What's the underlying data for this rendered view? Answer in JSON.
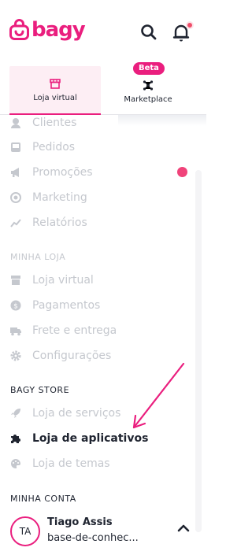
{
  "brand": {
    "name": "bagy",
    "accent": "#ea1e7e"
  },
  "header": {
    "search_icon": "search-icon",
    "bell_icon": "bell-icon"
  },
  "tabs": [
    {
      "label": "Loja virtual",
      "icon": "store-icon",
      "active": true
    },
    {
      "label": "Marketplace",
      "icon": "marketplace-icon",
      "badge": "Beta"
    }
  ],
  "menu": {
    "items_top": [
      {
        "label": "Clientes",
        "icon": "user-icon"
      },
      {
        "label": "Pedidos",
        "icon": "inbox-icon"
      },
      {
        "label": "Promoções",
        "icon": "megaphone-icon"
      },
      {
        "label": "Marketing",
        "icon": "target-icon"
      },
      {
        "label": "Relatórios",
        "icon": "chart-line-icon"
      }
    ],
    "section_loja": "MINHA LOJA",
    "items_loja": [
      {
        "label": "Loja virtual",
        "icon": "store-icon"
      },
      {
        "label": "Pagamentos",
        "icon": "dollar-icon"
      },
      {
        "label": "Frete e entrega",
        "icon": "truck-icon"
      },
      {
        "label": "Configurações",
        "icon": "gear-icon"
      }
    ],
    "section_store": "BAGY STORE",
    "items_store": [
      {
        "label": "Loja de serviços",
        "icon": "rocket-icon"
      },
      {
        "label": "Loja de aplicativos",
        "icon": "puzzle-icon",
        "active": true
      },
      {
        "label": "Loja de temas",
        "icon": "palette-icon"
      }
    ],
    "section_conta": "MINHA CONTA"
  },
  "account": {
    "initials": "TA",
    "name": "Tiago Assis",
    "subtitle": "base-de-conhec..."
  }
}
